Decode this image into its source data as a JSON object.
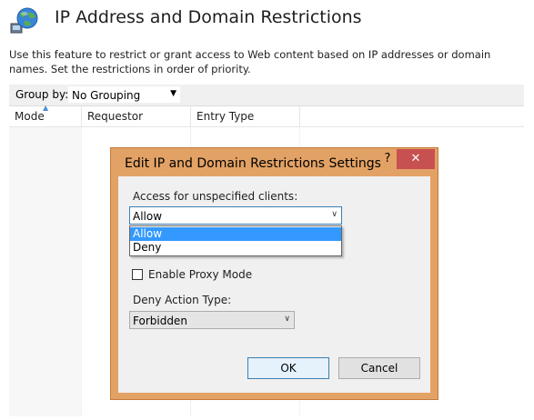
{
  "header": {
    "icon": "globe-network-icon",
    "title": "IP Address and Domain Restrictions",
    "description": "Use this feature to restrict or grant access to Web content based on IP addresses or domain names. Set the restrictions in order of priority."
  },
  "toolbar": {
    "group_by_label": "Group by:",
    "group_by_value": "No Grouping"
  },
  "table": {
    "columns": [
      "Mode",
      "Requestor",
      "Entry Type"
    ]
  },
  "dialog": {
    "title": "Edit IP and Domain Restrictions Settings",
    "help_label": "?",
    "close_label": "✕",
    "access_label": "Access for unspecified clients:",
    "access_value": "Allow",
    "access_options": [
      "Allow",
      "Deny"
    ],
    "proxy_mode_label": "Enable Proxy Mode",
    "proxy_mode_checked": false,
    "deny_action_label": "Deny Action Type:",
    "deny_action_value": "Forbidden",
    "ok_label": "OK",
    "cancel_label": "Cancel"
  },
  "colors": {
    "dialog_frame": "#e3a265",
    "close_button": "#c75050",
    "selection": "#3399ff"
  }
}
